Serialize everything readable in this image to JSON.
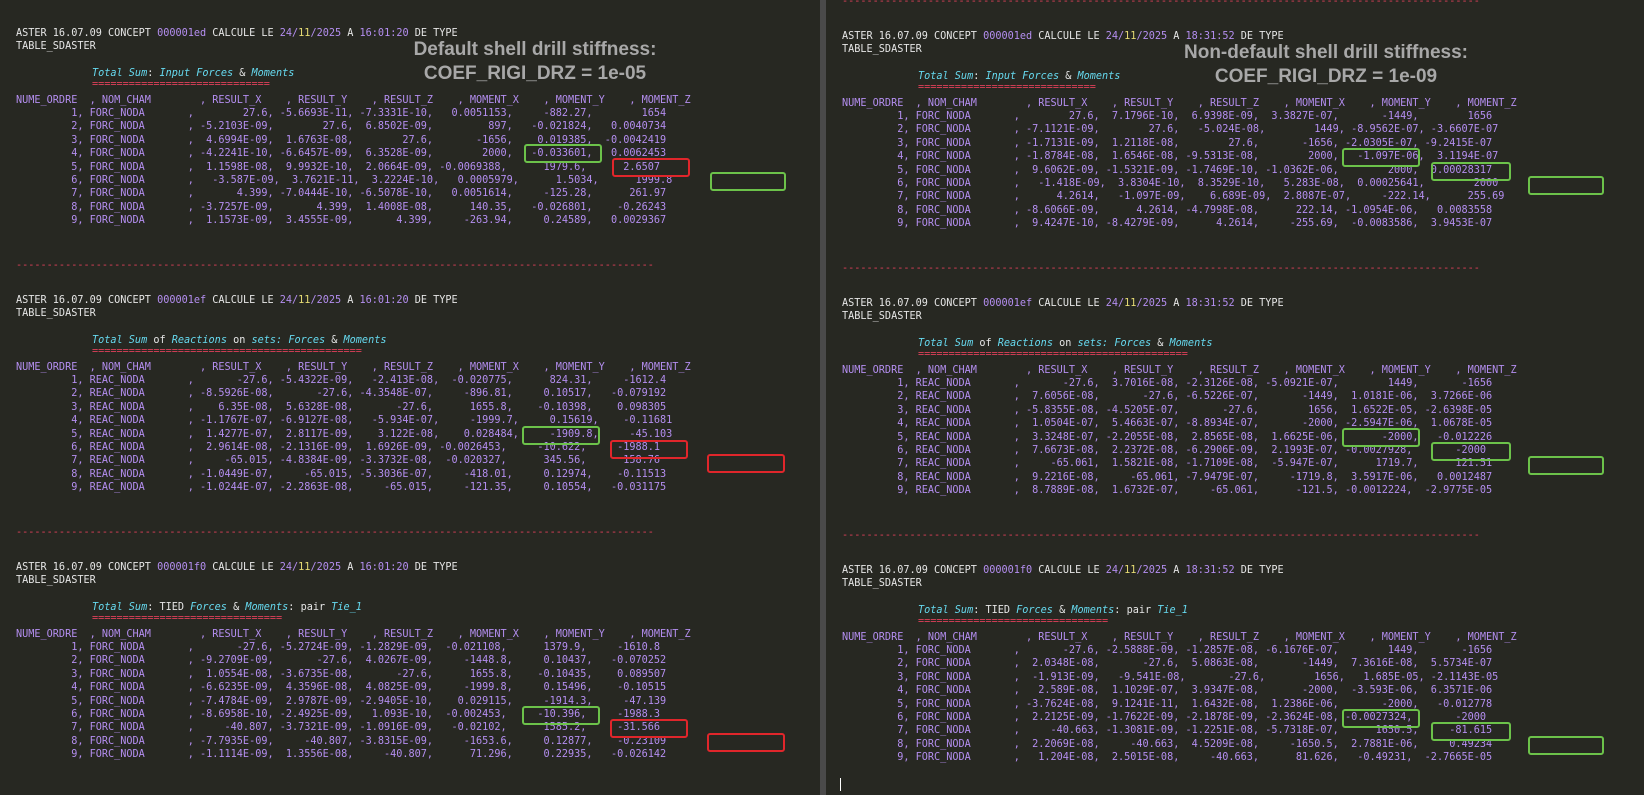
{
  "left": {
    "annotation": [
      "Default shell drill stiffness:",
      "COEF_RIGI_DRZ = 1e-05"
    ],
    "tables": [
      {
        "concept_line": [
          "ASTER 16.07.09 CONCEPT ",
          "000001ed",
          " CALCULE LE ",
          "24/",
          "11",
          "/2025",
          " A ",
          "16:01:20",
          " DE TYPE"
        ],
        "type": "TABLE_SDASTER",
        "title_parts": [
          "Total Sum",
          ": ",
          "Input Forces",
          " & ",
          "Moments"
        ],
        "underline": "=============================",
        "header": "NUME_ORDRE  , NOM_CHAM        , RESULT_X    , RESULT_Y    , RESULT_Z    , MOMENT_X    , MOMENT_Y    , MOMENT_Z",
        "rows": [
          "         1, FORC_NODA       ,        27.6, -5.6693E-11, -7.3331E-10,   0.0051153,     -882.27,        1654",
          "         2, FORC_NODA       , -5.2103E-09,        27.6,  6.8502E-09,         897,   -0.021824,   0.0040734",
          "         3, FORC_NODA       ,  4.6994E-09,  1.6763E-08,        27.6,       -1656,    0.019385,  -0.0042419",
          "         4, FORC_NODA       , -4.2241E-10, -6.6457E-09,  6.3528E-09,        2000,   -0.033601,   0.0062453",
          "         5, FORC_NODA       ,  1.1598E-08,  9.9932E-10,  2.0664E-09, -0.0069388,      1979.6,      2.6507",
          "         6, FORC_NODA       ,   -3.587E-09,  3.7621E-11,  3.2224E-10,   0.0005979,      1.5034,      1999.8",
          "         7, FORC_NODA       ,       4.399, -7.0444E-10, -6.5078E-10,   0.0051614,     -125.28,      261.97",
          "         8, FORC_NODA       , -3.7257E-09,       4.399,  1.4008E-08,      140.35,   -0.026801,    -0.26243",
          "         9, FORC_NODA       ,  1.1573E-09,  3.4555E-09,       4.399,     -263.94,     0.24589,   0.0029367"
        ]
      },
      {
        "concept_line": [
          "ASTER 16.07.09 CONCEPT ",
          "000001ef",
          " CALCULE LE ",
          "24/",
          "11",
          "/2025",
          " A ",
          "16:01:20",
          " DE TYPE"
        ],
        "type": "TABLE_SDASTER",
        "title_parts": [
          "Total Sum",
          " of ",
          "Reactions",
          " on ",
          "sets: ",
          "Forces",
          " & ",
          "Moments"
        ],
        "underline": "============================================",
        "header": "NUME_ORDRE  , NOM_CHAM        , RESULT_X    , RESULT_Y    , RESULT_Z    , MOMENT_X    , MOMENT_Y    , MOMENT_Z",
        "rows": [
          "         1, REAC_NODA       ,       -27.6, -5.4322E-09,   -2.413E-08,  -0.020775,      824.31,     -1612.4",
          "         2, REAC_NODA       , -8.5926E-08,       -27.6, -4.3548E-07,     -896.81,     0.10517,   -0.079192",
          "         3, REAC_NODA       ,    6.35E-08,  5.6328E-08,       -27.6,      1655.8,    -0.10398,    0.098305",
          "         4, REAC_NODA       , -1.1767E-07, -6.9127E-08,   -5.934E-07,     -1999.7,     0.15619,    -0.11681",
          "         5, REAC_NODA       ,  1.4277E-07,  2.8117E-09,    3.122E-08,    0.028484,     -1909.8,     -45.103",
          "         6, REAC_NODA       ,  2.9614E-08, -2.1316E-09,  1.6926E-09, -0.0026453,     -10.622,     -1988.1",
          "         7, REAC_NODA       ,     -65.015, -4.8384E-09, -3.3732E-08,  -0.020327,      345.56,      158.76",
          "         8, REAC_NODA       , -1.0449E-07,     -65.015, -5.3036E-07,     -418.01,     0.12974,    -0.11513",
          "         9, REAC_NODA       , -1.0244E-07, -2.2863E-08,     -65.015,     -121.35,     0.10554,   -0.031175"
        ]
      },
      {
        "concept_line": [
          "ASTER 16.07.09 CONCEPT ",
          "000001f0",
          " CALCULE LE ",
          "24/",
          "11",
          "/2025",
          " A ",
          "16:01:20",
          " DE TYPE"
        ],
        "type": "TABLE_SDASTER",
        "title_parts": [
          "Total Sum",
          ": TIED ",
          "Forces",
          " & ",
          "Moments",
          ": pair ",
          "Tie_1"
        ],
        "underline": "===============================",
        "header": "NUME_ORDRE  , NOM_CHAM        , RESULT_X    , RESULT_Y    , RESULT_Z    , MOMENT_X    , MOMENT_Y    , MOMENT_Z",
        "rows": [
          "         1, FORC_NODA       ,       -27.6, -5.2724E-09, -1.2829E-09,  -0.021108,      1379.9,     -1610.8",
          "         2, FORC_NODA       , -9.2709E-09,       -27.6,  4.0267E-09,     -1448.8,     0.10437,   -0.070252",
          "         3, FORC_NODA       ,  1.0554E-08, -3.6735E-08,       -27.6,      1655.8,    -0.10435,    0.089507",
          "         4, FORC_NODA       , -6.6235E-09,  4.3596E-08,  4.0825E-09,     -1999.8,     0.15496,    -0.10515",
          "         5, FORC_NODA       , -7.4784E-09,  2.9787E-09, -2.9405E-10,    0.029115,     -1914.3,     -47.139",
          "         6, FORC_NODA       , -8.6958E-10, -2.4925E-09,   1.093E-10,  -0.002453,     -10.396,     -1988.3",
          "         7, FORC_NODA       ,     -40.807, -3.7321E-09, -1.0916E-09,   -0.02102,      1585.2,     -31.566",
          "         8, FORC_NODA       , -7.7935E-09,     -40.807, -3.8315E-09,     -1653.6,     0.12877,    -0.23109",
          "         9, FORC_NODA       , -1.1114E-09,  1.3556E-08,     -40.807,      71.296,     0.22935,   -0.026142"
        ]
      }
    ]
  },
  "right": {
    "annotation": [
      "Non-default shell drill stiffness:",
      "COEF_RIGI_DRZ = 1e-09"
    ],
    "tables": [
      {
        "concept_line": [
          "ASTER 16.07.09 CONCEPT ",
          "000001ed",
          " CALCULE LE ",
          "24/",
          "11",
          "/2025",
          " A ",
          "18:31:52",
          " DE TYPE"
        ],
        "type": "TABLE_SDASTER",
        "title_parts": [
          "Total Sum",
          ": ",
          "Input Forces",
          " & ",
          "Moments"
        ],
        "underline": "=============================",
        "header": "NUME_ORDRE  , NOM_CHAM        , RESULT_X    , RESULT_Y    , RESULT_Z    , MOMENT_X    , MOMENT_Y    , MOMENT_Z",
        "rows": [
          "         1, FORC_NODA       ,        27.6,  7.1796E-10,  6.9398E-09,  3.3827E-07,       -1449,        1656",
          "         2, FORC_NODA       , -7.1121E-09,        27.6,   -5.024E-08,        1449, -8.9562E-07, -3.6607E-07",
          "         3, FORC_NODA       , -1.7131E-09,  1.2118E-08,        27.6,       -1656, -2.0305E-07, -9.2415E-07",
          "         4, FORC_NODA       , -1.8784E-08,  1.6546E-08, -9.5313E-08,        2000,   -1.097E-06,  3.1194E-07",
          "         5, FORC_NODA       ,  9.6062E-09, -1.5321E-09, -1.7469E-10, -1.0362E-06,        2000,  0.00028317",
          "         6, FORC_NODA       ,   -1.418E-09,  3.8304E-10,  8.3529E-10,   5.283E-08,  0.00025641,        2000",
          "         7, FORC_NODA       ,      4.2614,   -1.097E-09,    6.689E-09,  2.8087E-07,     -222.14,      255.69",
          "         8, FORC_NODA       , -8.6066E-09,      4.2614, -4.7998E-08,      222.14, -1.0954E-06,   0.0083558",
          "         9, FORC_NODA       ,  9.4247E-10, -8.4279E-09,      4.2614,     -255.69,  -0.0083586,  3.9453E-07"
        ]
      },
      {
        "concept_line": [
          "ASTER 16.07.09 CONCEPT ",
          "000001ef",
          " CALCULE LE ",
          "24/",
          "11",
          "/2025",
          " A ",
          "18:31:52",
          " DE TYPE"
        ],
        "type": "TABLE_SDASTER",
        "title_parts": [
          "Total Sum",
          " of ",
          "Reactions",
          " on ",
          "sets: ",
          "Forces",
          " & ",
          "Moments"
        ],
        "underline": "============================================",
        "header": "NUME_ORDRE  , NOM_CHAM        , RESULT_X    , RESULT_Y    , RESULT_Z    , MOMENT_X    , MOMENT_Y    , MOMENT_Z",
        "rows": [
          "         1, REAC_NODA       ,       -27.6,  3.7016E-08, -2.3126E-08, -5.0921E-07,        1449,       -1656",
          "         2, REAC_NODA       ,  7.6056E-08,       -27.6, -6.5226E-07,       -1449,  1.0181E-06,  3.7266E-06",
          "         3, REAC_NODA       , -5.8355E-08, -4.5205E-07,       -27.6,        1656,  1.6522E-05, -2.6398E-05",
          "         4, REAC_NODA       ,  1.0504E-07,  5.4663E-07, -8.8934E-07,       -2000, -2.5947E-06,  1.0678E-05",
          "         5, REAC_NODA       ,  3.3248E-07, -2.2055E-08,  2.8565E-08,  1.6625E-06,       -2000,   -0.012226",
          "         6, REAC_NODA       ,  7.6673E-08,  2.2372E-08, -6.2906E-09,  2.1993E-07, -0.0027928,       -2000",
          "         7, REAC_NODA       ,     -65.061,  1.5821E-08, -1.7109E-08,  -5.947E-07,      1719.7,      121.51",
          "         8, REAC_NODA       ,  9.2216E-08,     -65.061, -7.9479E-07,     -1719.8,  3.5917E-06,   0.0012487",
          "         9, REAC_NODA       ,  8.7889E-08,  1.6732E-07,     -65.061,      -121.5, -0.0012224,  -2.9775E-05"
        ]
      },
      {
        "concept_line": [
          "ASTER 16.07.09 CONCEPT ",
          "000001f0",
          " CALCULE LE ",
          "24/",
          "11",
          "/2025",
          " A ",
          "18:31:52",
          " DE TYPE"
        ],
        "type": "TABLE_SDASTER",
        "title_parts": [
          "Total Sum",
          ": TIED ",
          "Forces",
          " & ",
          "Moments",
          ": pair ",
          "Tie_1"
        ],
        "underline": "===============================",
        "header": "NUME_ORDRE  , NOM_CHAM        , RESULT_X    , RESULT_Y    , RESULT_Z    , MOMENT_X    , MOMENT_Y    , MOMENT_Z",
        "rows": [
          "         1, FORC_NODA       ,       -27.6, -2.5888E-09, -1.2857E-08, -6.1676E-07,        1449,       -1656",
          "         2, FORC_NODA       ,  2.0348E-08,       -27.6,  5.0863E-08,       -1449,  7.3616E-08,  5.5734E-07",
          "         3, FORC_NODA       ,  -1.913E-09,   -9.541E-08,       -27.6,        1656,   1.685E-05, -2.1143E-05",
          "         4, FORC_NODA       ,   2.589E-08,  1.1029E-07,  3.9347E-08,       -2000,  -3.593E-06,  6.3571E-06",
          "         5, FORC_NODA       , -3.7624E-08,  9.1241E-11,  1.6432E-08,  1.2386E-06,       -2000,   -0.012778",
          "         6, FORC_NODA       ,  2.2125E-09, -1.7622E-09, -2.1878E-09, -2.3624E-08, -0.0027324,       -2000",
          "         7, FORC_NODA       ,     -40.663, -1.3081E-09, -1.2251E-08, -5.7318E-07,      1650.5,     -81.615",
          "         8, FORC_NODA       ,  2.2069E-08,     -40.663,  4.5209E-08,     -1650.5,  2.7881E-06,     0.49234",
          "         9, FORC_NODA       ,   1.204E-08,  2.5015E-08,     -40.663,      81.626,   -0.49231,  -2.7665E-05"
        ]
      }
    ]
  },
  "separator": "--------------------------------------------------------------------------------------------------------",
  "colors": {
    "background": "#272822",
    "dashes": "#e0405a",
    "purple": "#b48ef0",
    "cyan": "#66d9ef",
    "yellow": "#e6db74",
    "green_box": "#6cc24a",
    "red_box": "#e0262b"
  }
}
